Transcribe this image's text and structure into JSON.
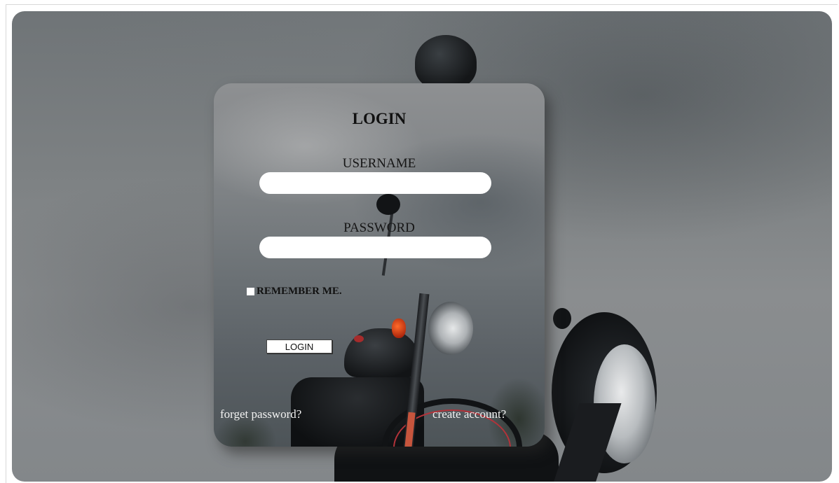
{
  "login_panel": {
    "title": "LOGIN",
    "username_label": "USERNAME",
    "username_value": "",
    "password_label": "PASSWORD",
    "password_value": "",
    "remember_label": "REMEMBER ME.",
    "remember_checked": false,
    "login_button_label": "LOGIN",
    "forget_password_link": "forget password?",
    "create_account_link": "create account?"
  },
  "colors": {
    "panel_overlay": "#7e8285",
    "input_background": "#ffffff",
    "link_text": "#f2f2f2",
    "heading_text": "#111111"
  }
}
